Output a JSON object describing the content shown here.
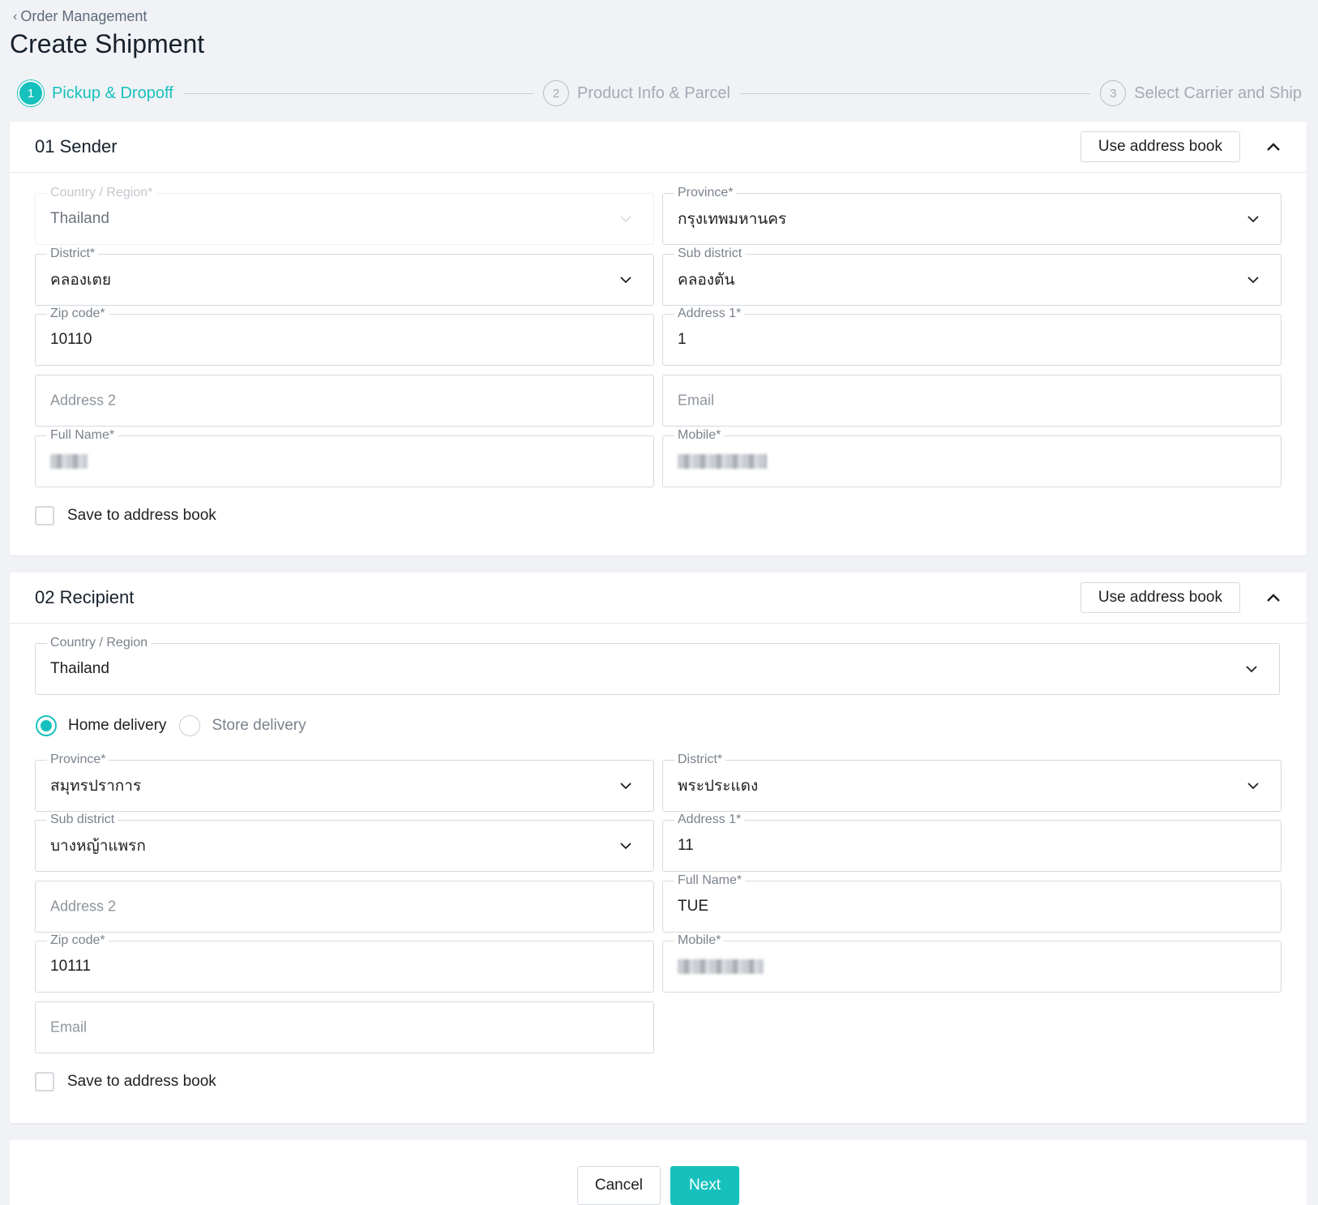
{
  "breadcrumb": {
    "back_label": "Order Management"
  },
  "page_title": "Create Shipment",
  "steps": [
    {
      "number": "1",
      "label": "Pickup & Dropoff"
    },
    {
      "number": "2",
      "label": "Product Info & Parcel"
    },
    {
      "number": "3",
      "label": "Select Carrier and Ship"
    }
  ],
  "colors": {
    "accent": "#16c1bd",
    "page_bg": "#f0f2f5",
    "border": "#d5d9de"
  },
  "sender": {
    "title": "01 Sender",
    "use_address_book": "Use address book",
    "country": {
      "label": "Country / Region",
      "required": "*",
      "value": "Thailand"
    },
    "province": {
      "label": "Province",
      "required": "*",
      "value": "กรุงเทพมหานคร"
    },
    "district": {
      "label": "District",
      "required": "*",
      "value": "คลองเตย"
    },
    "sub_district": {
      "label": "Sub district",
      "value": "คลองตัน"
    },
    "zip": {
      "label": "Zip code",
      "required": "*",
      "value": "10110"
    },
    "address1": {
      "label": "Address 1",
      "required": "*",
      "value": "1"
    },
    "address2": {
      "placeholder": "Address 2"
    },
    "email": {
      "placeholder": "Email"
    },
    "full_name": {
      "label": "Full Name",
      "required": "*"
    },
    "mobile": {
      "label": "Mobile",
      "required": "*"
    },
    "save_label": "Save to address book"
  },
  "recipient": {
    "title": "02 Recipient",
    "use_address_book": "Use address book",
    "country": {
      "label": "Country / Region",
      "value": "Thailand"
    },
    "delivery_options": [
      "Home delivery",
      "Store delivery"
    ],
    "province": {
      "label": "Province",
      "required": "*",
      "value": "สมุทรปราการ"
    },
    "district": {
      "label": "District",
      "required": "*",
      "value": "พระประแดง"
    },
    "sub_district": {
      "label": "Sub district",
      "value": "บางหญ้าแพรก"
    },
    "address1": {
      "label": "Address 1",
      "required": "*",
      "value": "11"
    },
    "address2": {
      "placeholder": "Address 2"
    },
    "full_name": {
      "label": "Full Name",
      "required": "*",
      "value": "TUE"
    },
    "zip": {
      "label": "Zip code",
      "required": "*",
      "value": "10111"
    },
    "mobile": {
      "label": "Mobile",
      "required": "*"
    },
    "email": {
      "placeholder": "Email"
    },
    "save_label": "Save to address book"
  },
  "footer": {
    "cancel_label": "Cancel",
    "next_label": "Next"
  }
}
